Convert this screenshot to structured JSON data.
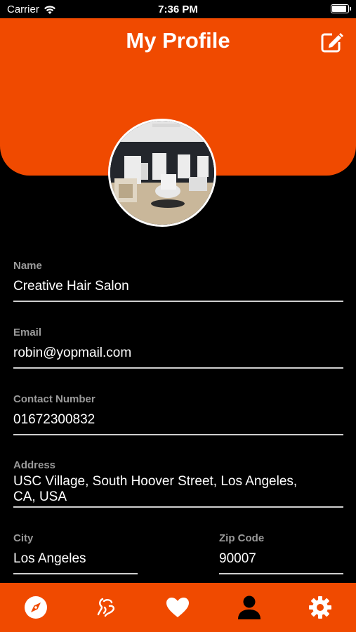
{
  "status_bar": {
    "carrier": "Carrier",
    "time": "7:36 PM"
  },
  "header": {
    "title": "My Profile",
    "edit_icon": "edit-icon"
  },
  "avatar": {
    "description_icon": "salon-photo"
  },
  "fields": {
    "name": {
      "label": "Name",
      "value": "Creative Hair Salon"
    },
    "email": {
      "label": "Email",
      "value": "robin@yopmail.com"
    },
    "contact": {
      "label": "Contact Number",
      "value": "01672300832"
    },
    "address": {
      "label": "Address",
      "value_line1": "USC Village, South Hoover Street, Los Angeles,",
      "value_line2": "CA, USA"
    },
    "city": {
      "label": "City",
      "value": "Los Angeles"
    },
    "zip": {
      "label": "Zip Code",
      "value": "90007"
    }
  },
  "tabbar": {
    "items": [
      "compass-icon",
      "hair-icon",
      "heart-icon",
      "profile-icon",
      "settings-icon"
    ],
    "active": "profile-icon"
  },
  "colors": {
    "accent": "#f04a00",
    "background": "#000000",
    "label": "#9a9a9a"
  }
}
